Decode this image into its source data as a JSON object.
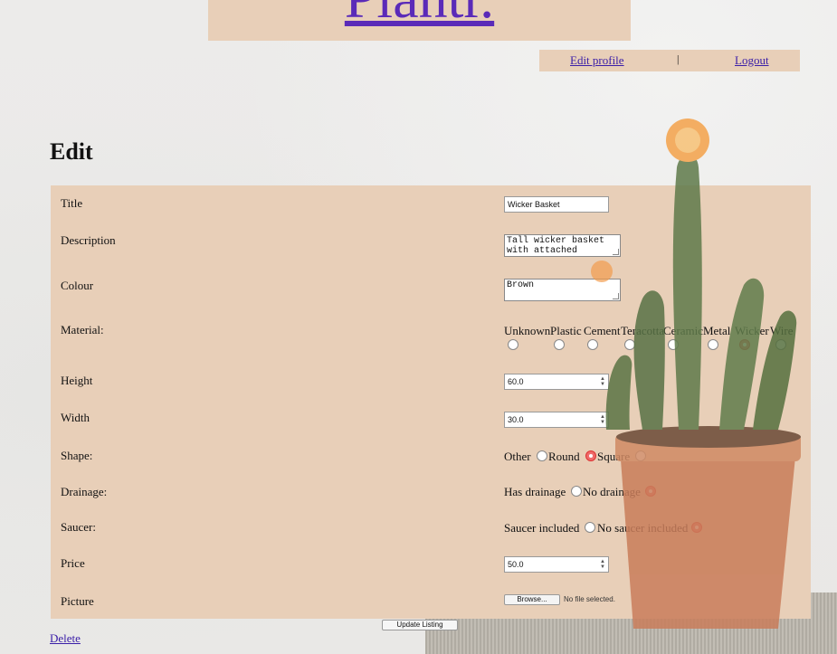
{
  "header": {
    "site_title": "Plantr."
  },
  "nav": {
    "edit_profile": "Edit profile",
    "separator": "|",
    "logout": "Logout"
  },
  "page": {
    "heading": "Edit"
  },
  "form": {
    "title_label": "Title",
    "title_value": "Wicker Basket",
    "description_label": "Description",
    "description_value": "Tall wicker basket\nwith attached",
    "colour_label": "Colour",
    "colour_value": "Brown",
    "material_label": "Material:",
    "material_options": [
      "Unknown",
      "Plastic",
      "Cement",
      "Teracotta",
      "Ceramic",
      "Metal",
      "Wicker",
      "Wire"
    ],
    "material_selected": "Wicker",
    "height_label": "Height",
    "height_value": "60.0",
    "width_label": "Width",
    "width_value": "30.0",
    "shape_label": "Shape:",
    "shape_options": [
      "Other",
      "Round",
      "Square"
    ],
    "shape_selected": "Round",
    "drainage_label": "Drainage:",
    "drainage_options": [
      "Has drainage",
      "No drainage"
    ],
    "drainage_selected": "No drainage",
    "saucer_label": "Saucer:",
    "saucer_options": [
      "Saucer included",
      "No saucer included"
    ],
    "saucer_selected": "No saucer included",
    "price_label": "Price",
    "price_value": "50.0",
    "picture_label": "Picture",
    "browse_label": "Browse...",
    "file_status": "No file selected.",
    "update_label": "Update Listing"
  },
  "actions": {
    "delete_label": "Delete"
  },
  "colors": {
    "panel": "#e8cfb8",
    "link": "#3a1ea8",
    "title_link": "#5a2ab8",
    "radio_checked": "#ef6a6a"
  }
}
